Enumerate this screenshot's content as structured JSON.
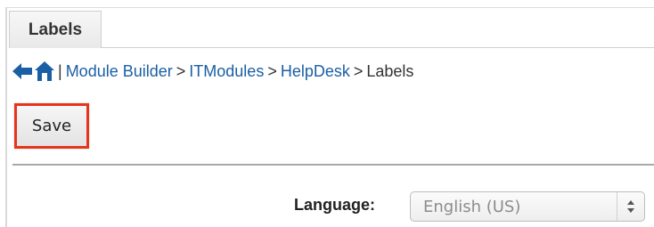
{
  "tab": {
    "label": "Labels"
  },
  "breadcrumb": {
    "icons": [
      "back-arrow-icon",
      "home-icon"
    ],
    "separator": "|",
    "arrow": ">",
    "items": [
      {
        "label": "Module Builder"
      },
      {
        "label": "ITModules"
      },
      {
        "label": "HelpDesk"
      }
    ],
    "current": "Labels"
  },
  "toolbar": {
    "save_label": "Save"
  },
  "language": {
    "label": "Language:",
    "selected": "English (US)"
  },
  "colors": {
    "link": "#1a5fa5",
    "highlight": "#e8341c"
  }
}
